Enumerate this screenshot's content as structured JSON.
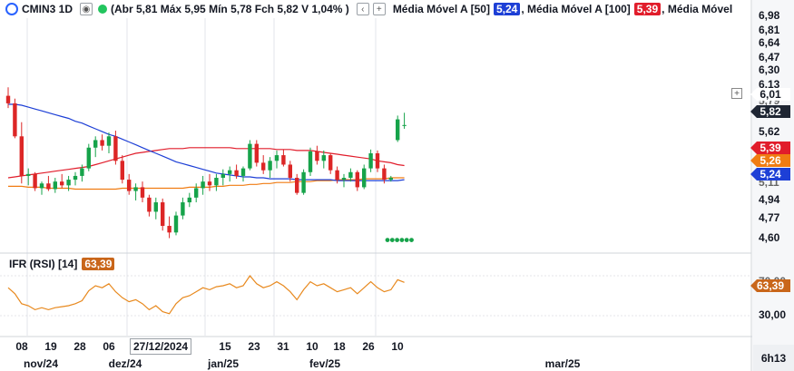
{
  "header": {
    "symbol": "CMIN3 1D",
    "ohlc": "(Abr 5,81 Máx 5,95 Mín 5,78 Fch 5,82 V 1,04% )",
    "ma50_label": "Média Móvel A [50]",
    "ma50_value": "5,24",
    "ma100_label": ", Média Móvel A [100]",
    "ma100_value": "5,39",
    "ma_third_label": ", Média Móvel"
  },
  "price_axis": {
    "ticks": [
      "6,98",
      "6,81",
      "6,64",
      "6,47",
      "6,30",
      "6,13",
      "5,62",
      "4,94",
      "4,77",
      "4,60"
    ],
    "tag_last_line": "6,01",
    "tag_last": "5,82",
    "tag_ma100": "5,39",
    "tag_ma_orange": "5,26",
    "tag_ma50": "5,24",
    "partial_ticks": [
      "5,79",
      "5,11"
    ]
  },
  "rsi": {
    "label": "IFR (RSI) [14]",
    "value": "63,39",
    "axis_ticks": [
      "70,00",
      "30,00"
    ],
    "tag": "63,39"
  },
  "x_axis": {
    "days": [
      "08",
      "19",
      "28",
      "06",
      "15",
      "23",
      "31",
      "10",
      "18",
      "26",
      "10"
    ],
    "highlight": "27/12/2024",
    "months": [
      "nov/24",
      "dez/24",
      "jan/25",
      "fev/25",
      "mar/25"
    ],
    "time": "6h13"
  },
  "colors": {
    "up": "#16a34a",
    "down": "#dc2626",
    "ma50": "#1d3fd6",
    "ma100": "#e11d2b",
    "ma_orange": "#f07c12",
    "rsi": "#e8891e",
    "last_tag": "#1f2633"
  },
  "chart_data": {
    "type": "candlestick",
    "candles": [
      [
        6.13,
        6.22,
        6.0,
        6.05
      ],
      [
        6.05,
        6.1,
        5.68,
        5.7
      ],
      [
        5.7,
        5.85,
        5.2,
        5.28
      ],
      [
        5.28,
        5.36,
        5.18,
        5.3
      ],
      [
        5.3,
        5.32,
        5.12,
        5.15
      ],
      [
        5.15,
        5.22,
        5.08,
        5.2
      ],
      [
        5.2,
        5.28,
        5.12,
        5.14
      ],
      [
        5.14,
        5.26,
        5.1,
        5.22
      ],
      [
        5.22,
        5.3,
        5.15,
        5.18
      ],
      [
        5.18,
        5.28,
        5.12,
        5.24
      ],
      [
        5.24,
        5.32,
        5.18,
        5.28
      ],
      [
        5.28,
        5.4,
        5.22,
        5.36
      ],
      [
        5.36,
        5.62,
        5.33,
        5.58
      ],
      [
        5.58,
        5.7,
        5.48,
        5.66
      ],
      [
        5.66,
        5.72,
        5.55,
        5.6
      ],
      [
        5.6,
        5.74,
        5.52,
        5.7
      ],
      [
        5.7,
        5.76,
        5.4,
        5.44
      ],
      [
        5.44,
        5.5,
        5.2,
        5.24
      ],
      [
        5.24,
        5.3,
        5.08,
        5.12
      ],
      [
        5.12,
        5.2,
        5.02,
        5.16
      ],
      [
        5.16,
        5.22,
        5.0,
        5.05
      ],
      [
        5.05,
        5.08,
        4.85,
        4.9
      ],
      [
        4.9,
        5.05,
        4.82,
        5.0
      ],
      [
        5.0,
        5.04,
        4.7,
        4.75
      ],
      [
        4.75,
        4.85,
        4.62,
        4.68
      ],
      [
        4.68,
        4.9,
        4.65,
        4.86
      ],
      [
        4.86,
        5.05,
        4.82,
        5.0
      ],
      [
        5.0,
        5.1,
        4.95,
        5.05
      ],
      [
        5.05,
        5.2,
        5.0,
        5.15
      ],
      [
        5.15,
        5.28,
        5.08,
        5.22
      ],
      [
        5.22,
        5.3,
        5.12,
        5.18
      ],
      [
        5.18,
        5.3,
        5.12,
        5.26
      ],
      [
        5.26,
        5.35,
        5.18,
        5.3
      ],
      [
        5.3,
        5.38,
        5.22,
        5.34
      ],
      [
        5.34,
        5.4,
        5.25,
        5.28
      ],
      [
        5.28,
        5.38,
        5.22,
        5.36
      ],
      [
        5.36,
        5.66,
        5.34,
        5.62
      ],
      [
        5.62,
        5.66,
        5.38,
        5.42
      ],
      [
        5.42,
        5.5,
        5.3,
        5.34
      ],
      [
        5.34,
        5.48,
        5.26,
        5.44
      ],
      [
        5.44,
        5.55,
        5.36,
        5.5
      ],
      [
        5.5,
        5.56,
        5.38,
        5.4
      ],
      [
        5.4,
        5.44,
        5.22,
        5.26
      ],
      [
        5.26,
        5.3,
        5.08,
        5.1
      ],
      [
        5.1,
        5.35,
        5.08,
        5.32
      ],
      [
        5.32,
        5.58,
        5.28,
        5.54
      ],
      [
        5.54,
        5.6,
        5.4,
        5.44
      ],
      [
        5.44,
        5.55,
        5.36,
        5.5
      ],
      [
        5.5,
        5.52,
        5.3,
        5.34
      ],
      [
        5.34,
        5.38,
        5.2,
        5.24
      ],
      [
        5.24,
        5.3,
        5.16,
        5.26
      ],
      [
        5.26,
        5.36,
        5.22,
        5.32
      ],
      [
        5.32,
        5.34,
        5.12,
        5.16
      ],
      [
        5.16,
        5.4,
        5.14,
        5.36
      ],
      [
        5.36,
        5.56,
        5.32,
        5.52
      ],
      [
        5.52,
        5.55,
        5.32,
        5.36
      ],
      [
        5.36,
        5.4,
        5.2,
        5.24
      ],
      [
        5.24,
        5.28,
        5.22,
        5.26
      ],
      [
        5.66,
        5.92,
        5.64,
        5.88
      ],
      [
        5.81,
        5.95,
        5.78,
        5.82
      ]
    ],
    "ma50": [
      6.04,
      6.04,
      6.03,
      6.01,
      5.99,
      5.97,
      5.95,
      5.93,
      5.91,
      5.89,
      5.86,
      5.84,
      5.81,
      5.78,
      5.75,
      5.72,
      5.7,
      5.67,
      5.64,
      5.61,
      5.58,
      5.55,
      5.52,
      5.49,
      5.46,
      5.43,
      5.41,
      5.39,
      5.37,
      5.35,
      5.33,
      5.31,
      5.3,
      5.29,
      5.28,
      5.27,
      5.27,
      5.26,
      5.26,
      5.25,
      5.25,
      5.25,
      5.25,
      5.24,
      5.24,
      5.24,
      5.24,
      5.24,
      5.24,
      5.23,
      5.23,
      5.23,
      5.23,
      5.23,
      5.23,
      5.23,
      5.23,
      5.23,
      5.23,
      5.24
    ],
    "ma100": [
      5.26,
      5.27,
      5.28,
      5.29,
      5.3,
      5.31,
      5.32,
      5.33,
      5.34,
      5.35,
      5.36,
      5.37,
      5.38,
      5.4,
      5.42,
      5.44,
      5.46,
      5.48,
      5.5,
      5.52,
      5.53,
      5.54,
      5.55,
      5.56,
      5.57,
      5.57,
      5.57,
      5.58,
      5.58,
      5.58,
      5.58,
      5.58,
      5.58,
      5.58,
      5.57,
      5.57,
      5.57,
      5.57,
      5.57,
      5.57,
      5.56,
      5.56,
      5.56,
      5.55,
      5.55,
      5.55,
      5.54,
      5.53,
      5.52,
      5.51,
      5.5,
      5.49,
      5.48,
      5.47,
      5.46,
      5.44,
      5.43,
      5.42,
      5.4,
      5.39
    ],
    "ma_orange": [
      5.17,
      5.17,
      5.17,
      5.16,
      5.16,
      5.16,
      5.15,
      5.15,
      5.15,
      5.15,
      5.14,
      5.14,
      5.14,
      5.14,
      5.14,
      5.14,
      5.14,
      5.15,
      5.15,
      5.15,
      5.15,
      5.15,
      5.15,
      5.15,
      5.15,
      5.15,
      5.15,
      5.16,
      5.16,
      5.16,
      5.16,
      5.17,
      5.17,
      5.18,
      5.18,
      5.18,
      5.19,
      5.19,
      5.2,
      5.2,
      5.21,
      5.21,
      5.21,
      5.22,
      5.22,
      5.22,
      5.23,
      5.23,
      5.23,
      5.24,
      5.24,
      5.24,
      5.24,
      5.25,
      5.25,
      5.25,
      5.25,
      5.26,
      5.26,
      5.26
    ],
    "rsi": [
      58,
      52,
      42,
      40,
      36,
      38,
      36,
      38,
      39,
      40,
      42,
      45,
      55,
      60,
      58,
      62,
      54,
      48,
      44,
      46,
      42,
      36,
      40,
      34,
      32,
      42,
      48,
      50,
      54,
      58,
      56,
      59,
      60,
      62,
      58,
      60,
      70,
      62,
      58,
      60,
      64,
      60,
      54,
      46,
      56,
      64,
      60,
      62,
      58,
      54,
      56,
      58,
      52,
      58,
      64,
      58,
      54,
      56,
      66,
      63.39
    ],
    "price_range": [
      4.5,
      7.05
    ],
    "rsi_range": [
      10,
      90
    ],
    "green_dots_price": 4.6
  }
}
